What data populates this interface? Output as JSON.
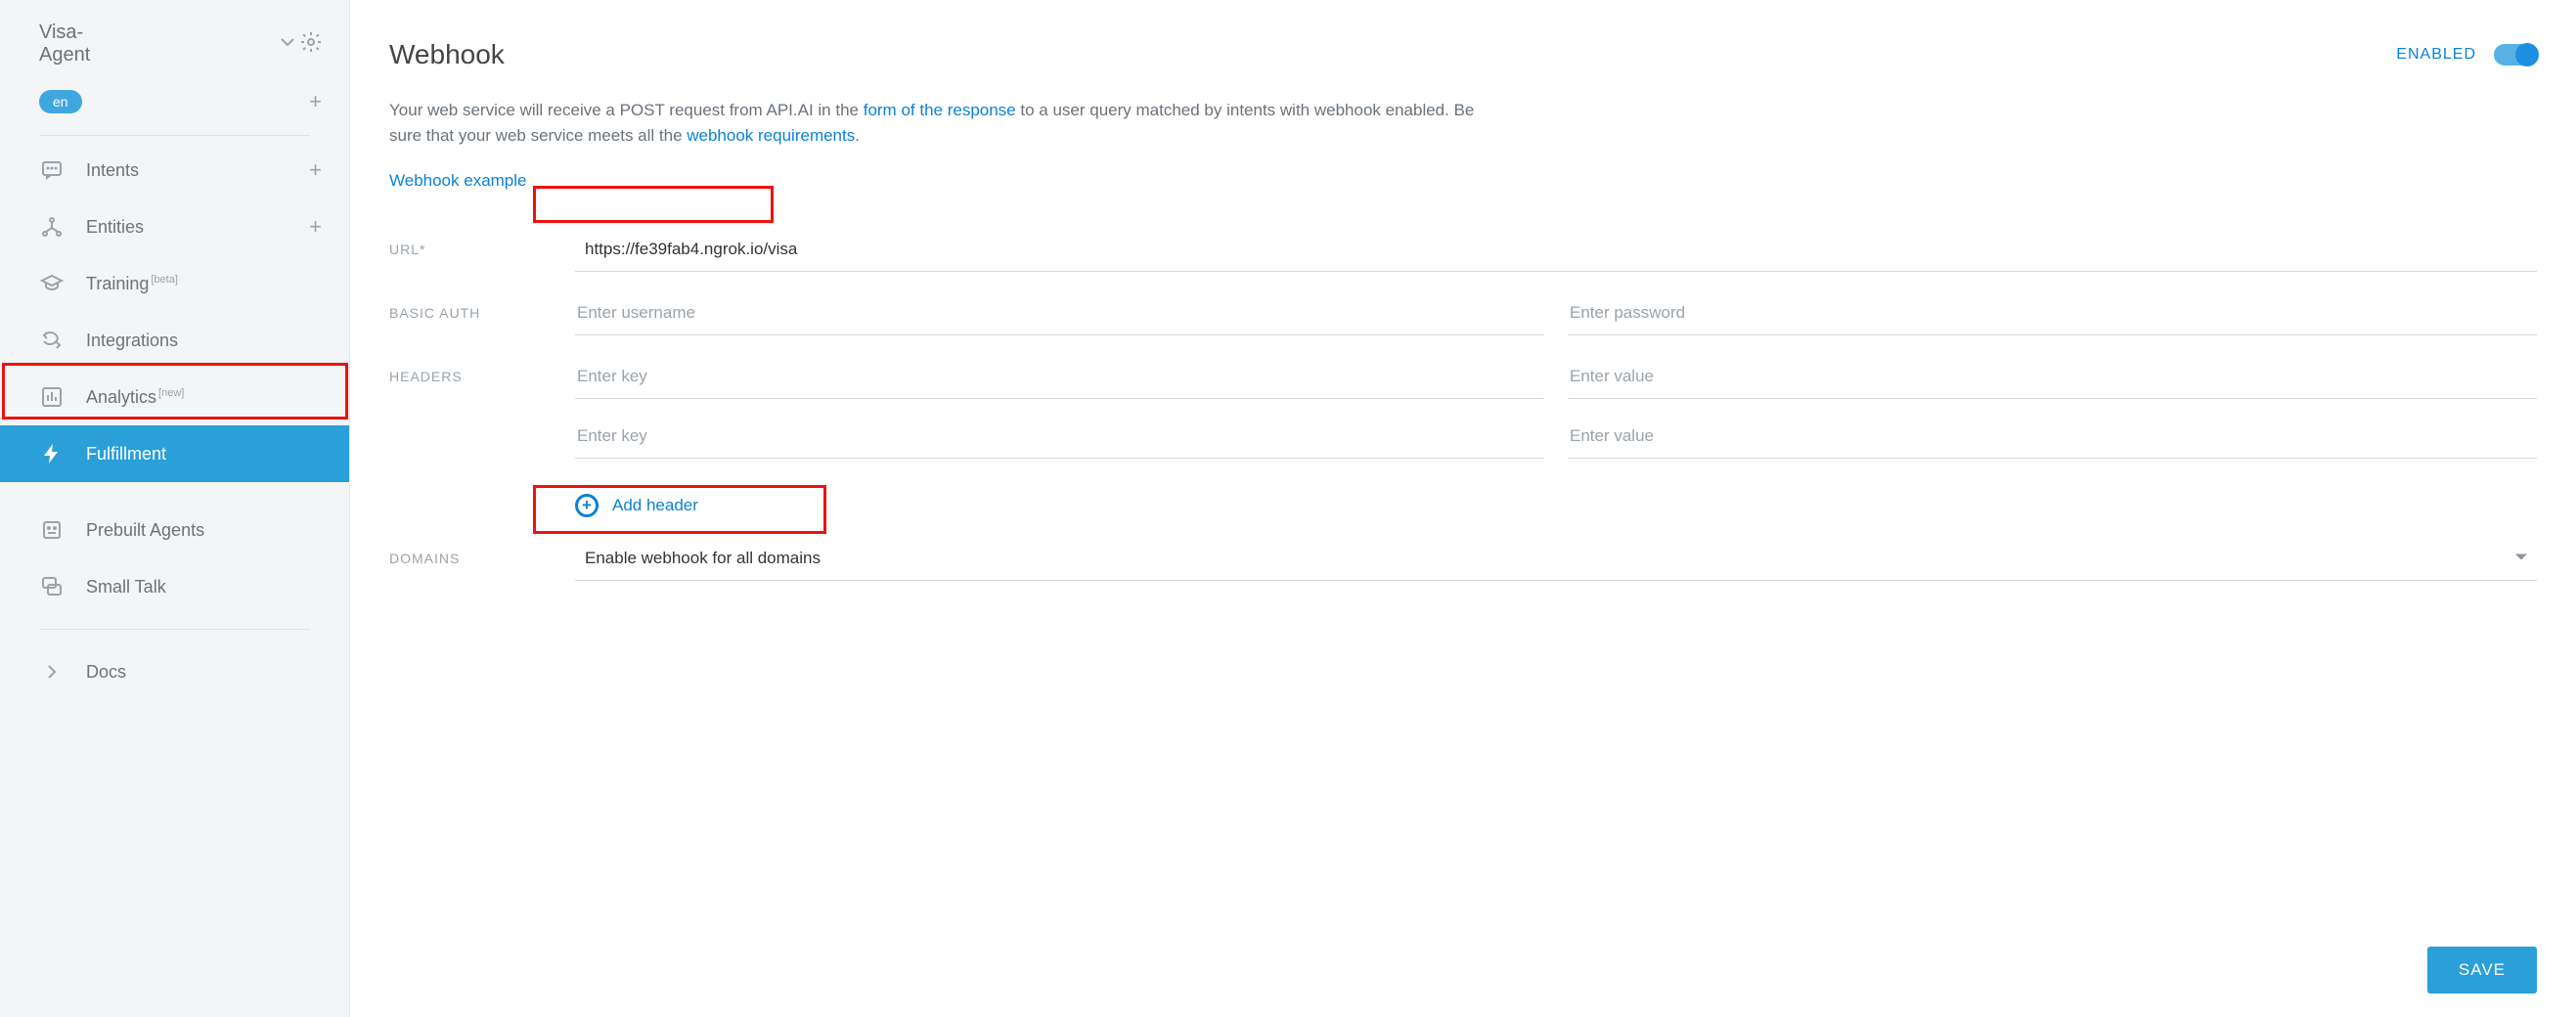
{
  "agent": {
    "name": "Visa-Agent",
    "language": "en"
  },
  "sidebar": {
    "items": [
      {
        "label": "Intents",
        "has_add": true
      },
      {
        "label": "Entities",
        "has_add": true
      },
      {
        "label": "Training",
        "sup": "[beta]"
      },
      {
        "label": "Integrations"
      },
      {
        "label": "Analytics",
        "sup": "[new]"
      },
      {
        "label": "Fulfillment",
        "active": true
      },
      {
        "label": "Prebuilt Agents"
      },
      {
        "label": "Small Talk"
      },
      {
        "label": "Docs"
      }
    ]
  },
  "page": {
    "title": "Webhook",
    "enabled_label": "ENABLED",
    "intro_prefix": "Your web service will receive a POST request from API.AI in the ",
    "intro_link1": "form of the response",
    "intro_mid": " to a user query matched by intents with webhook enabled. Be sure that your web service meets all the ",
    "intro_link2": "webhook requirements",
    "intro_suffix": ".",
    "example_link": "Webhook example"
  },
  "form": {
    "url_label": "URL*",
    "url_value": "https://fe39fab4.ngrok.io/visa",
    "auth_label": "BASIC AUTH",
    "auth_user_placeholder": "Enter username",
    "auth_pass_placeholder": "Enter password",
    "headers_label": "HEADERS",
    "header_key_placeholder": "Enter key",
    "header_value_placeholder": "Enter value",
    "add_header_label": "Add header",
    "domains_label": "DOMAINS",
    "domains_value": "Enable webhook for all domains",
    "save_label": "SAVE"
  }
}
